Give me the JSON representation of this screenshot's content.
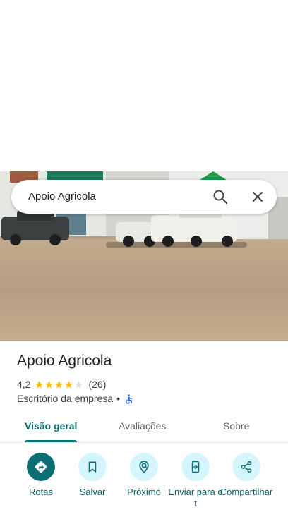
{
  "search": {
    "query": "Apoio Agricola"
  },
  "place": {
    "title": "Apoio Agricola",
    "rating": "4,2",
    "stars_filled": 4,
    "stars_total": 5,
    "review_count": "(26)",
    "category": "Escritório da empresa",
    "separator": "•"
  },
  "tabs": [
    {
      "label": "Visão geral",
      "active": true
    },
    {
      "label": "Avaliações",
      "active": false
    },
    {
      "label": "Sobre",
      "active": false
    }
  ],
  "actions": [
    {
      "label": "Rotas",
      "icon": "directions-icon"
    },
    {
      "label": "Salvar",
      "icon": "bookmark-icon"
    },
    {
      "label": "Próximo",
      "icon": "nearby-icon"
    },
    {
      "label": "Enviar para o t",
      "icon": "send-to-phone-icon"
    },
    {
      "label": "Compartilhar",
      "icon": "share-icon"
    }
  ],
  "colors": {
    "accent": "#0b6e74",
    "action_bg": "#d3f5fb",
    "star": "#fbbc04",
    "star_empty": "#dadce0",
    "accessibility": "#1a73e8"
  }
}
